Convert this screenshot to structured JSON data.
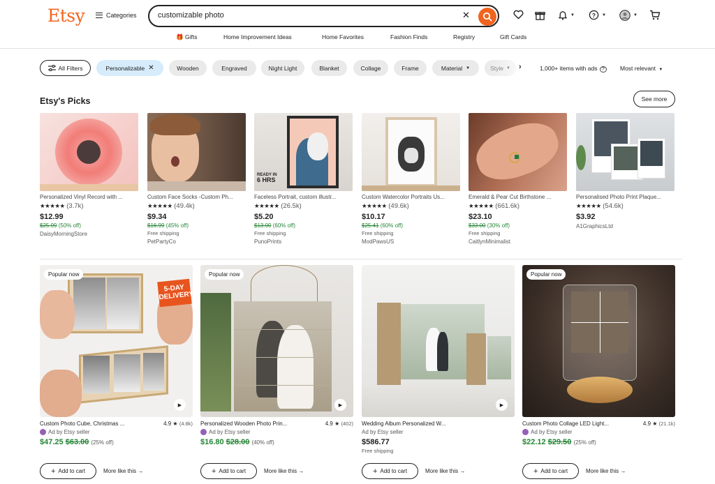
{
  "header": {
    "logo": "Etsy",
    "categories_label": "Categories",
    "search_value": "customizable photo",
    "nav": [
      "Gifts",
      "Home Improvement Ideas",
      "Home Favorites",
      "Fashion Finds",
      "Registry",
      "Gift Cards"
    ]
  },
  "filters": {
    "all_filters": "All Filters",
    "chips": [
      "Personalizable",
      "Wooden",
      "Engraved",
      "Night Light",
      "Blanket",
      "Collage",
      "Frame",
      "Material",
      "Style"
    ],
    "results": "1,000+ items with ads",
    "sort": "Most relevant"
  },
  "picks": {
    "title": "Etsy's Picks",
    "see_more": "See more",
    "items": [
      {
        "title": "Personalized Vinyl Record with ...",
        "stars": "★★★★★",
        "reviews": "(3.7k)",
        "price": "$12.99",
        "orig": "$25.99",
        "disc": "(50% off)",
        "ship": "",
        "shop": "DaisyMorningStore"
      },
      {
        "title": "Custom Face Socks -Custom Ph...",
        "stars": "★★★★★",
        "reviews": "(49.4k)",
        "price": "$9.34",
        "orig": "$16.99",
        "disc": "(45% off)",
        "ship": "Free shipping",
        "shop": "PetPartyCo"
      },
      {
        "title": "Faceless Portrait, custom illustr...",
        "stars": "★★★★★",
        "reviews": "(26.5k)",
        "price": "$5.20",
        "orig": "$13.00",
        "disc": "(60% off)",
        "ship": "Free shipping",
        "shop": "PunoPrints"
      },
      {
        "title": "Custom Watercolor Portraits Us...",
        "stars": "★★★★★",
        "reviews": "(49.6k)",
        "price": "$10.17",
        "orig": "$25.41",
        "disc": "(60% off)",
        "ship": "Free shipping",
        "shop": "ModPawsUS"
      },
      {
        "title": "Emerald & Pear Cut Birthstone ...",
        "stars": "★★★★★",
        "reviews": "(661.6k)",
        "price": "$23.10",
        "orig": "$33.00",
        "disc": "(30% off)",
        "ship": "Free shipping",
        "shop": "CaitlynMinimalist"
      },
      {
        "title": "Personalised Photo Print Plaque...",
        "stars": "★★★★★",
        "reviews": "(54.6k)",
        "price": "$3.92",
        "orig": "",
        "disc": "",
        "ship": "",
        "shop": "A1GraphicsLtd"
      }
    ]
  },
  "listings": [
    {
      "badge": "Popular now",
      "title": "Custom Photo Cube, Christmas ...",
      "rating": "4.9 ★",
      "reviews": "(4.8k)",
      "ad": "Ad by Etsy seller",
      "price": "$47.25",
      "orig": "$63.00",
      "disc": "(25% off)",
      "ship": "",
      "add": "Add to cart",
      "more": "More like this",
      "overlay": "5-DAY DELIVERY"
    },
    {
      "badge": "Popular now",
      "title": "Personalized Wooden Photo Prin...",
      "rating": "4.9 ★",
      "reviews": "(402)",
      "ad": "Ad by Etsy seller",
      "price": "$16.80",
      "orig": "$28.00",
      "disc": "(40% off)",
      "ship": "",
      "add": "Add to cart",
      "more": "More like this",
      "overlay": ""
    },
    {
      "badge": "",
      "title": "Wedding Album Personalized W...",
      "rating": "",
      "reviews": "",
      "ad": "Ad by Etsy seller",
      "price": "$586.77",
      "orig": "",
      "disc": "",
      "ship": "Free shipping",
      "add": "Add to cart",
      "more": "More like this",
      "overlay": ""
    },
    {
      "badge": "Popular now",
      "title": "Custom Photo Collage LED Light...",
      "rating": "4.9 ★",
      "reviews": "(21.1k)",
      "ad": "Ad by Etsy seller",
      "price": "$22.12",
      "orig": "$29.50",
      "disc": "(25% off)",
      "ship": "",
      "add": "Add to cart",
      "more": "More like this",
      "overlay": ""
    }
  ],
  "colors": {
    "brand": "#f1641e",
    "sale": "#258635",
    "chip_selected": "#d7ecfa"
  }
}
